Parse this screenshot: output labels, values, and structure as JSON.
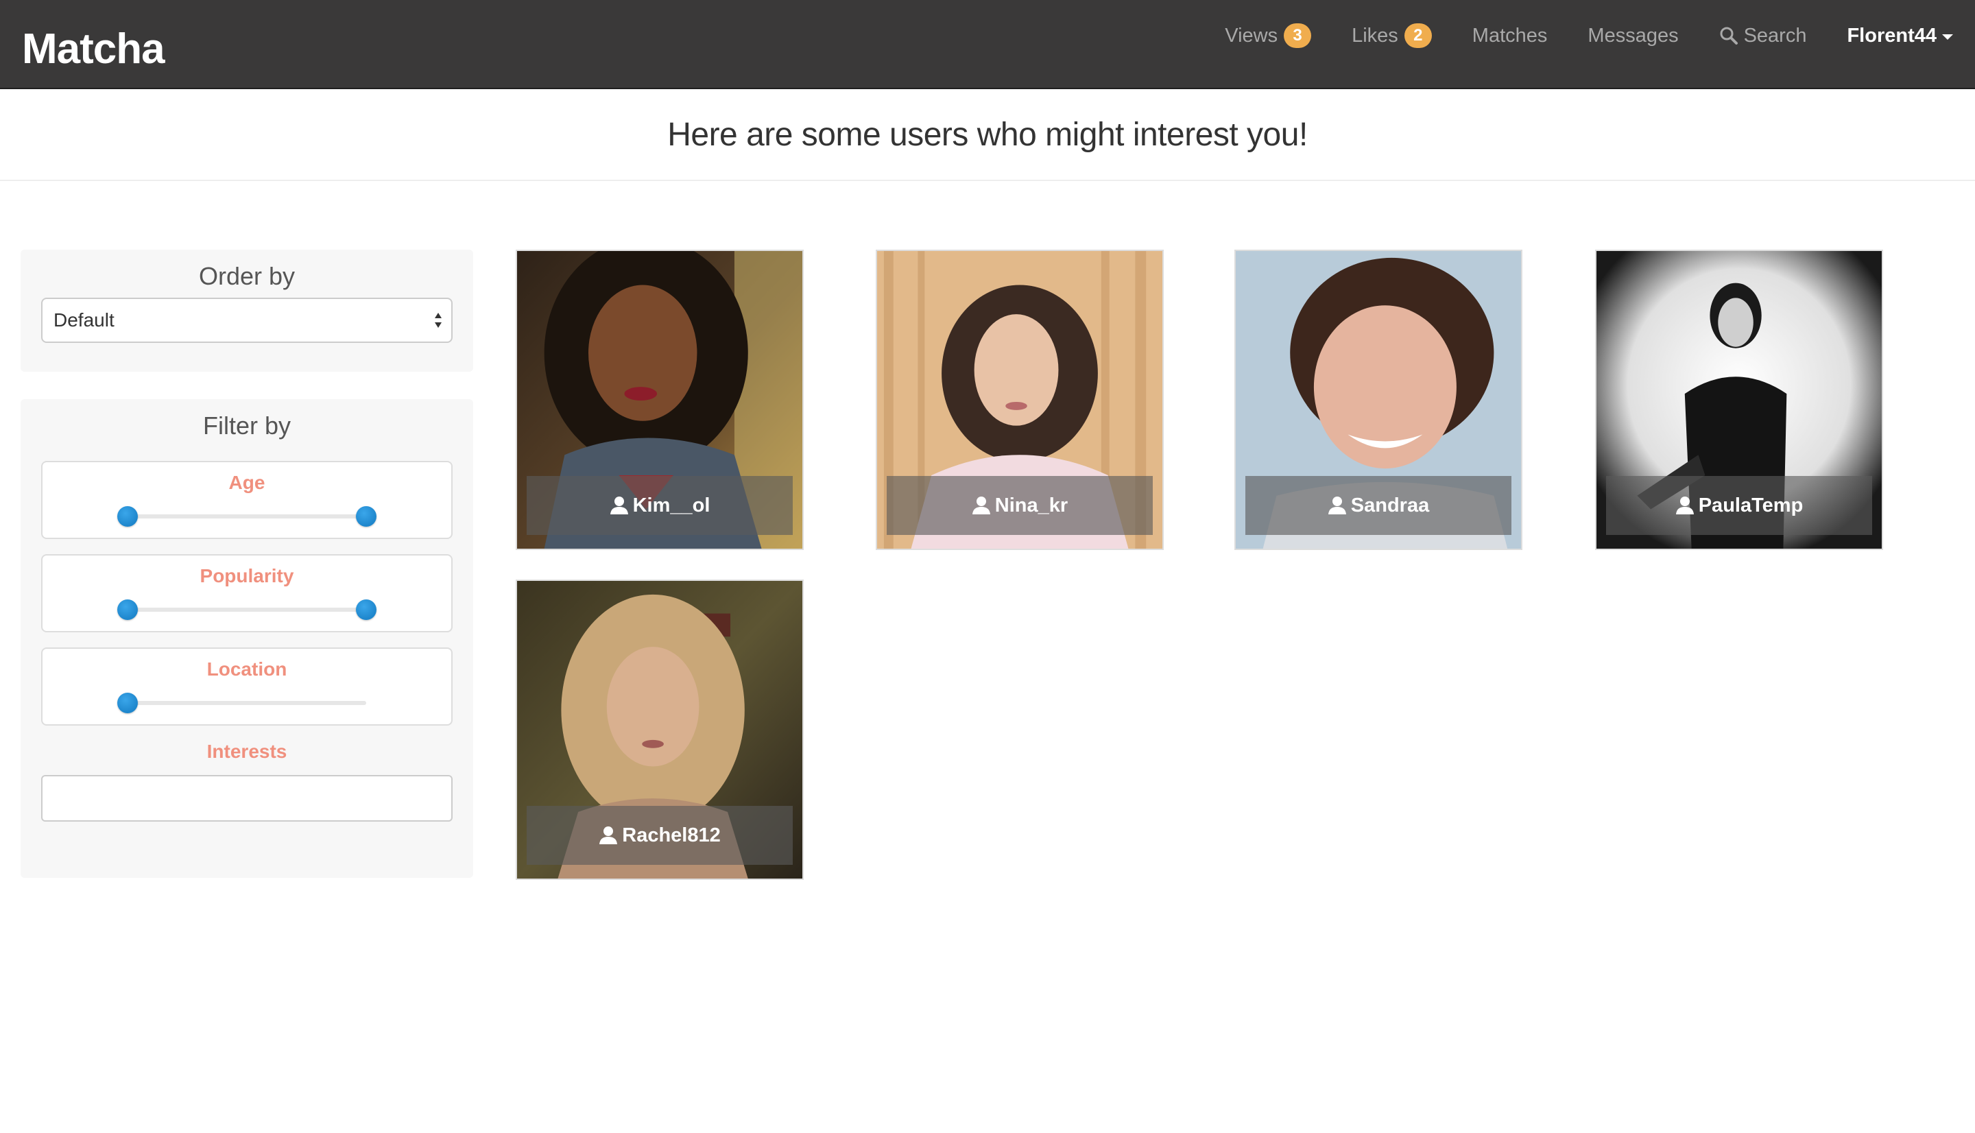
{
  "navbar": {
    "brand": "Matcha",
    "items": [
      {
        "label": "Views",
        "badge": "3"
      },
      {
        "label": "Likes",
        "badge": "2"
      },
      {
        "label": "Matches"
      },
      {
        "label": "Messages"
      },
      {
        "label": "Search",
        "icon": "search-icon"
      }
    ],
    "user": "Florent44"
  },
  "page": {
    "title": "Here are some users who might interest you!"
  },
  "order_panel": {
    "title": "Order by",
    "selected": "Default"
  },
  "filter_panel": {
    "title": "Filter by",
    "sliders": [
      {
        "label": "Age",
        "range": [
          0.0,
          1.0
        ]
      },
      {
        "label": "Popularity",
        "range": [
          0.0,
          1.0
        ]
      },
      {
        "label": "Location",
        "value": 0.0
      }
    ],
    "interests_label": "Interests",
    "interests_value": ""
  },
  "users": [
    {
      "username": "Kim__ol"
    },
    {
      "username": "Nina_kr"
    },
    {
      "username": "Sandraa"
    },
    {
      "username": "PaulaTemp"
    },
    {
      "username": "Rachel812"
    }
  ],
  "colors": {
    "navbar_bg": "#3a3939",
    "badge": "#f0ad4e",
    "slider_label": "#f0907e",
    "slider_handle": "#1e86cc",
    "panel_bg": "#f7f7f7"
  }
}
